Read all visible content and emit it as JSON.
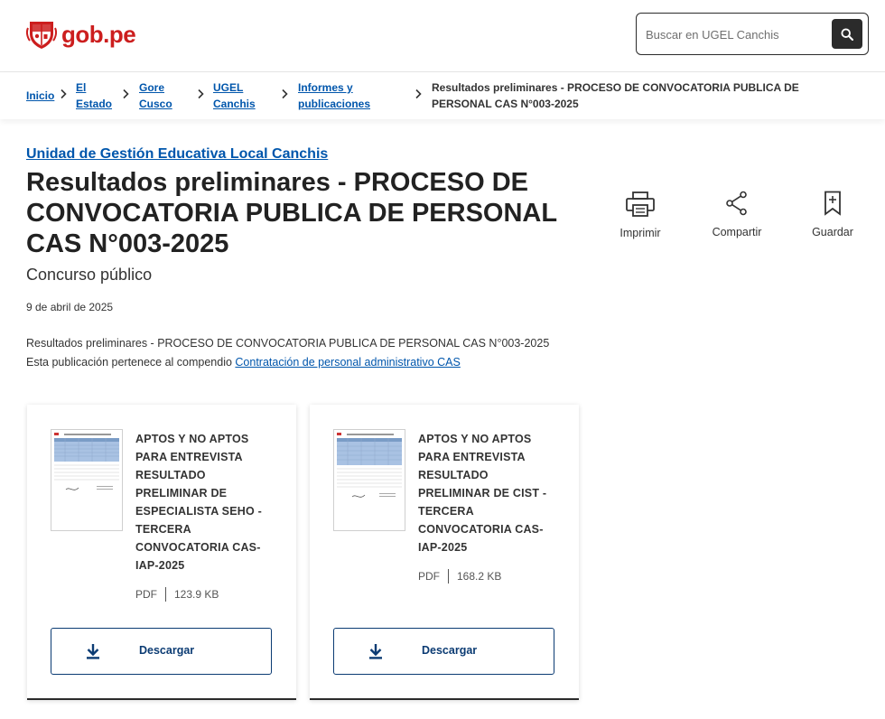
{
  "header": {
    "logo_text": "gob.pe",
    "search_placeholder": "Buscar en UGEL Canchis"
  },
  "breadcrumb": {
    "items": [
      {
        "line1": "Inicio",
        "line2": ""
      },
      {
        "line1": "El",
        "line2": "Estado"
      },
      {
        "line1": "Gore",
        "line2": "Cusco"
      },
      {
        "line1": "UGEL",
        "line2": "Canchis"
      },
      {
        "line1": "Informes y",
        "line2": "publicaciones"
      }
    ],
    "current": "Resultados preliminares - PROCESO DE CONVOCATORIA PUBLICA DE PERSONAL CAS N°003-2025"
  },
  "content": {
    "org_link": "Unidad de Gestión Educativa Local Canchis",
    "title": "Resultados preliminares - PROCESO DE CONVOCATORIA PUBLICA DE PERSONAL CAS N°003-2025",
    "subtitle": "Concurso público",
    "date": "9 de abril de 2025",
    "description": "Resultados preliminares - PROCESO DE CONVOCATORIA PUBLICA DE PERSONAL CAS N°003-2025",
    "compendium_prefix": "Esta publicación pertenece al compendio ",
    "compendium_link": "Contratación de personal administrativo CAS"
  },
  "actions": {
    "print": "Imprimir",
    "share": "Compartir",
    "save": "Guardar"
  },
  "documents": [
    {
      "title": "APTOS Y NO APTOS PARA ENTREVISTA RESULTADO PRELIMINAR DE ESPECIALISTA SEHO - TERCERA CONVOCATORIA CAS-IAP-2025",
      "format": "PDF",
      "size": "123.9 KB",
      "download_label": "Descargar"
    },
    {
      "title": "APTOS Y NO APTOS PARA ENTREVISTA RESULTADO PRELIMINAR DE CIST - TERCERA CONVOCATORIA CAS-IAP-2025",
      "format": "PDF",
      "size": "168.2 KB",
      "download_label": "Descargar"
    }
  ],
  "colors": {
    "brand_red": "#cc1e1e",
    "link_blue": "#0056ac",
    "button_navy": "#0b3b73",
    "dark": "#2b2b2b"
  },
  "icons": {
    "logo": "peru-shield-icon",
    "search": "search-icon",
    "chevron": "chevron-right-icon",
    "print": "printer-icon",
    "share": "share-icon",
    "save": "bookmark-icon",
    "download": "download-icon"
  }
}
